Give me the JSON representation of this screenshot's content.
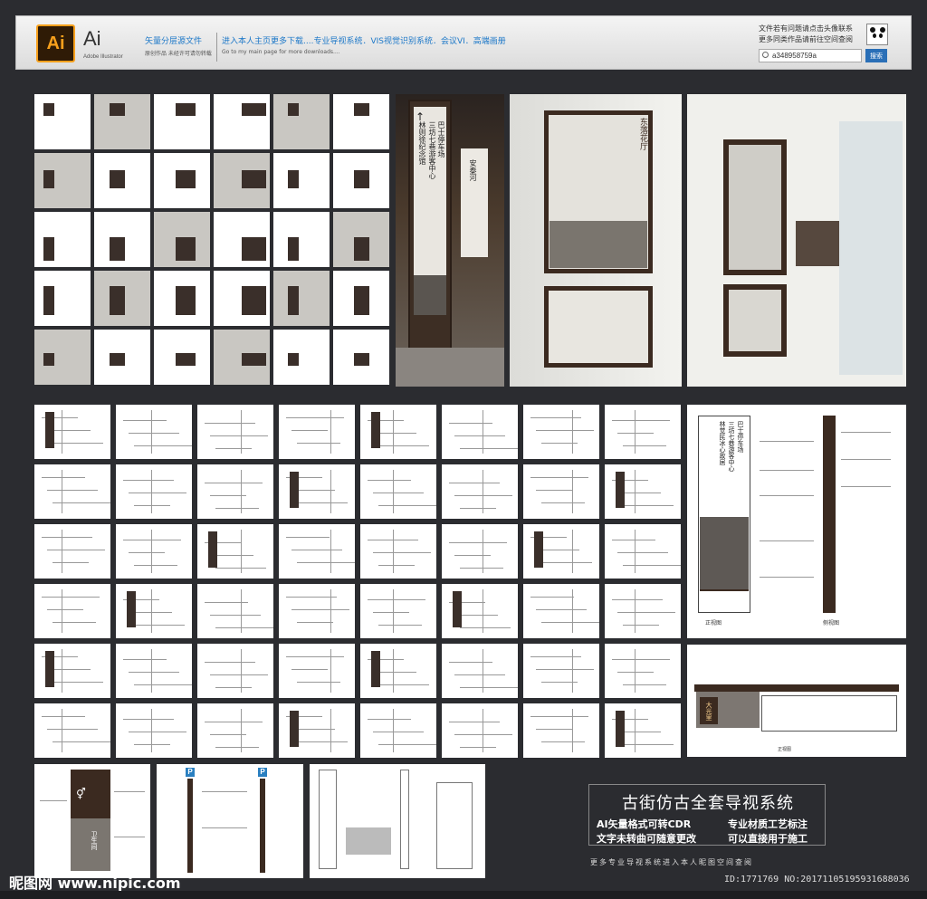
{
  "banner": {
    "app_icon": "Ai",
    "app_name": "Ai",
    "app_sub": "Adobe Illustrator",
    "tag1": "矢量分层源文件",
    "tag1_sub": "原创作品 未经许可请勿转载",
    "tag2": "进入本人主页更多下载....专业导视系统．VIS视觉识别系统．会议VI．高端画册",
    "tag2_sub": "Go to my main page for more downloads....",
    "contact1": "文件若有问题请点击头像联系",
    "contact2": "更多同类作品请前往空间查阅",
    "search_value": "a348958759a",
    "search_button": "搜索"
  },
  "renders": {
    "sign1_arrow_top": "↑",
    "sign1_col1": "巴士停车场",
    "sign1_col2": "三坊七巷游客中心",
    "sign1_col3": "林则徐纪念馆",
    "sign1_right": "安泰河",
    "sign2_title": "东落花厅"
  },
  "detail_sign": {
    "col1": "巴士停车场",
    "col2": "三坊七巷游客中心",
    "col3": "林觉民冰心故居",
    "side_label": "侧视图",
    "front_label": "正视图",
    "plate_title": "大光里",
    "toilet_label": "卫生间"
  },
  "promo": {
    "title": "古街仿古全套导视系统",
    "line1a": "AI矢量格式可转CDR",
    "line1b": "专业材质工艺标注",
    "line2a": "文字未转曲可随意更改",
    "line2b": "可以直接用于施工",
    "more": "更多专业导视系统进入本人昵图空间查阅"
  },
  "footer": {
    "watermark": "昵图网 www.nipic.com",
    "id_line": "ID:1771769 NO:20171105195931688036"
  },
  "colors": {
    "background": "#2b2c30",
    "accent_blue": "#1d78c8",
    "ai_orange": "#f7a01c",
    "wood": "#3b2a20",
    "parking_blue": "#2a7fc0"
  }
}
